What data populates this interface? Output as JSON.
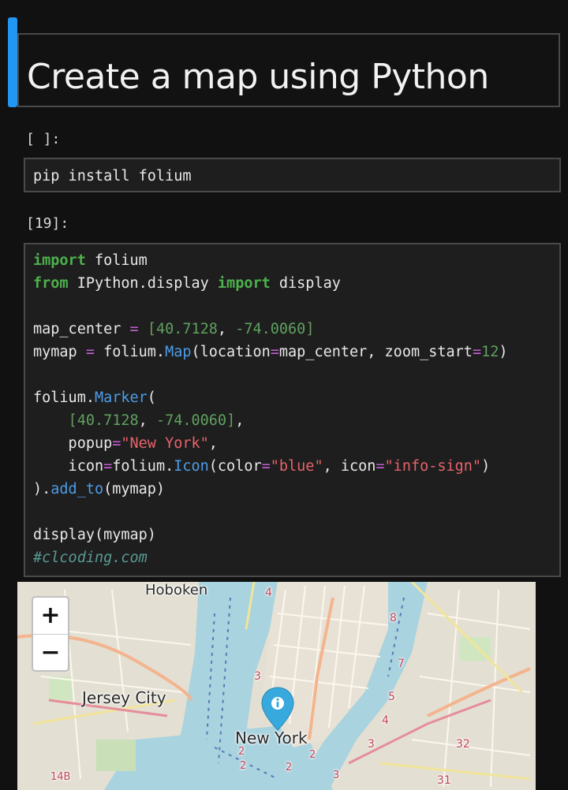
{
  "markdown_cell": {
    "title": "Create a map using Python"
  },
  "cell1": {
    "prompt": "[ ]:",
    "code": "pip install folium"
  },
  "cell2": {
    "prompt": "[19]:"
  },
  "code": {
    "l1_kw": "import",
    "l1_rest": " folium",
    "l2_kw1": "from",
    "l2_mod": " IPython.display ",
    "l2_kw2": "import",
    "l2_rest": " display",
    "l4_var": "map_center ",
    "l4_eq": "=",
    "l4_sp": " ",
    "l4_lb": "[",
    "l4_n1": "40.7128",
    "l4_comma": ", ",
    "l4_n2": "-74.0060",
    "l4_rb": "]",
    "l5_var": "mymap ",
    "l5_eq": "=",
    "l5_obj": " folium.",
    "l5_fn": "Map",
    "l5_a1": "(location",
    "l5_eq2": "=",
    "l5_a2": "map_center, zoom_start",
    "l5_eq3": "=",
    "l5_n": "12",
    "l5_end": ")",
    "l7_obj": "folium.",
    "l7_fn": "Marker",
    "l7_p": "(",
    "l8_ind": "    ",
    "l8_lb": "[",
    "l8_n1": "40.7128",
    "l8_comma": ", ",
    "l8_n2": "-74.0060",
    "l8_rb": "]",
    "l8_end": ",",
    "l9_a": "    popup",
    "l9_eq": "=",
    "l9_s": "\"New York\"",
    "l9_end": ",",
    "l10_a": "    icon",
    "l10_eq": "=",
    "l10_obj": "folium.",
    "l10_fn": "Icon",
    "l10_a2": "(color",
    "l10_eq2": "=",
    "l10_s1": "\"blue\"",
    "l10_a3": ", icon",
    "l10_eq3": "=",
    "l10_s2": "\"info-sign\"",
    "l10_end": ")",
    "l11_a": ").",
    "l11_fn": "add_to",
    "l11_end": "(mymap)",
    "l13": "display(mymap)",
    "l14_comment": "#clcoding.com"
  },
  "map": {
    "zoom_in": "+",
    "zoom_out": "−",
    "labels": {
      "hoboken": "Hoboken",
      "jersey_city": "Jersey City",
      "new_york": "New York",
      "r4a": "4",
      "r8": "8",
      "r7": "7",
      "r3a": "3",
      "r5": "5",
      "r4b": "4",
      "r3b": "3",
      "r32": "32",
      "r31": "31",
      "r2a": "2",
      "r2b": "2",
      "r2c": "2",
      "r14b": "14B",
      "r2d": "2",
      "r3c": "3"
    },
    "marker_icon": "info-sign",
    "marker_color": "#38a9dc",
    "water_color": "#a9d3df",
    "land_color": "#e4dfd3"
  }
}
